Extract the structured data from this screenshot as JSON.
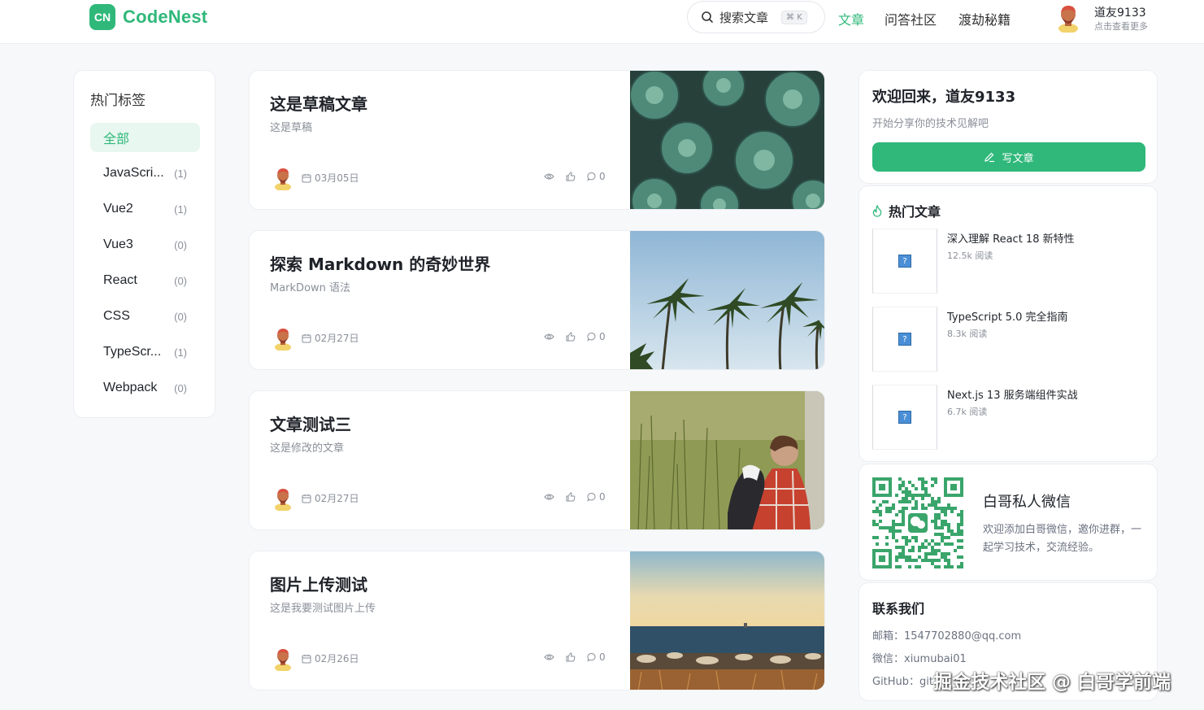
{
  "header": {
    "logo_badge": "CN",
    "logo_text": "CodeNest",
    "search_placeholder": "搜索文章",
    "search_shortcut": "⌘ K",
    "nav": [
      "文章",
      "问答社区",
      "渡劫秘籍"
    ],
    "active_nav": "文章",
    "user_name": "道友9133",
    "user_hint": "点击查看更多"
  },
  "tags": {
    "title": "热门标签",
    "items": [
      {
        "name": "全部",
        "count": ""
      },
      {
        "name": "JavaScri...",
        "count": "(1)"
      },
      {
        "name": "Vue2",
        "count": "(1)"
      },
      {
        "name": "Vue3",
        "count": "(0)"
      },
      {
        "name": "React",
        "count": "(0)"
      },
      {
        "name": "CSS",
        "count": "(0)"
      },
      {
        "name": "TypeScr...",
        "count": "(1)"
      },
      {
        "name": "Webpack",
        "count": "(0)"
      }
    ]
  },
  "articles": [
    {
      "title": "这是草稿文章",
      "desc": "这是草稿",
      "date": "03月05日",
      "views": "",
      "likes": "",
      "comments": "0"
    },
    {
      "title": "探索 Markdown 的奇妙世界",
      "desc": "MarkDown 语法",
      "date": "02月27日",
      "views": "",
      "likes": "",
      "comments": "0"
    },
    {
      "title": "文章测试三",
      "desc": "这是修改的文章",
      "date": "02月27日",
      "views": "",
      "likes": "",
      "comments": "0"
    },
    {
      "title": "图片上传测试",
      "desc": "这是我要测试图片上传",
      "date": "02月26日",
      "views": "",
      "likes": "",
      "comments": "0"
    }
  ],
  "welcome": {
    "title": "欢迎回来，道友9133",
    "subtitle": "开始分享你的技术见解吧",
    "button": "写文章"
  },
  "hot": {
    "title": "热门文章",
    "items": [
      {
        "name": "深入理解 React 18 新特性",
        "reads": "12.5k 阅读"
      },
      {
        "name": "TypeScript 5.0 完全指南",
        "reads": "8.3k 阅读"
      },
      {
        "name": "Next.js 13 服务端组件实战",
        "reads": "6.7k 阅读"
      }
    ]
  },
  "wechat": {
    "title": "白哥私人微信",
    "desc": "欢迎添加白哥微信，邀你进群，一起学习技术，交流经验。"
  },
  "contact": {
    "title": "联系我们",
    "email": "邮箱：1547702880@qq.com",
    "wechat": "微信：xiumubai01",
    "github": "GitHub：git"
  },
  "watermark": "掘金技术社区 @ 白哥学前端",
  "colors": {
    "accent": "#2fb87a",
    "accent_light": "#e8f7ef",
    "muted": "#8a8f99"
  }
}
